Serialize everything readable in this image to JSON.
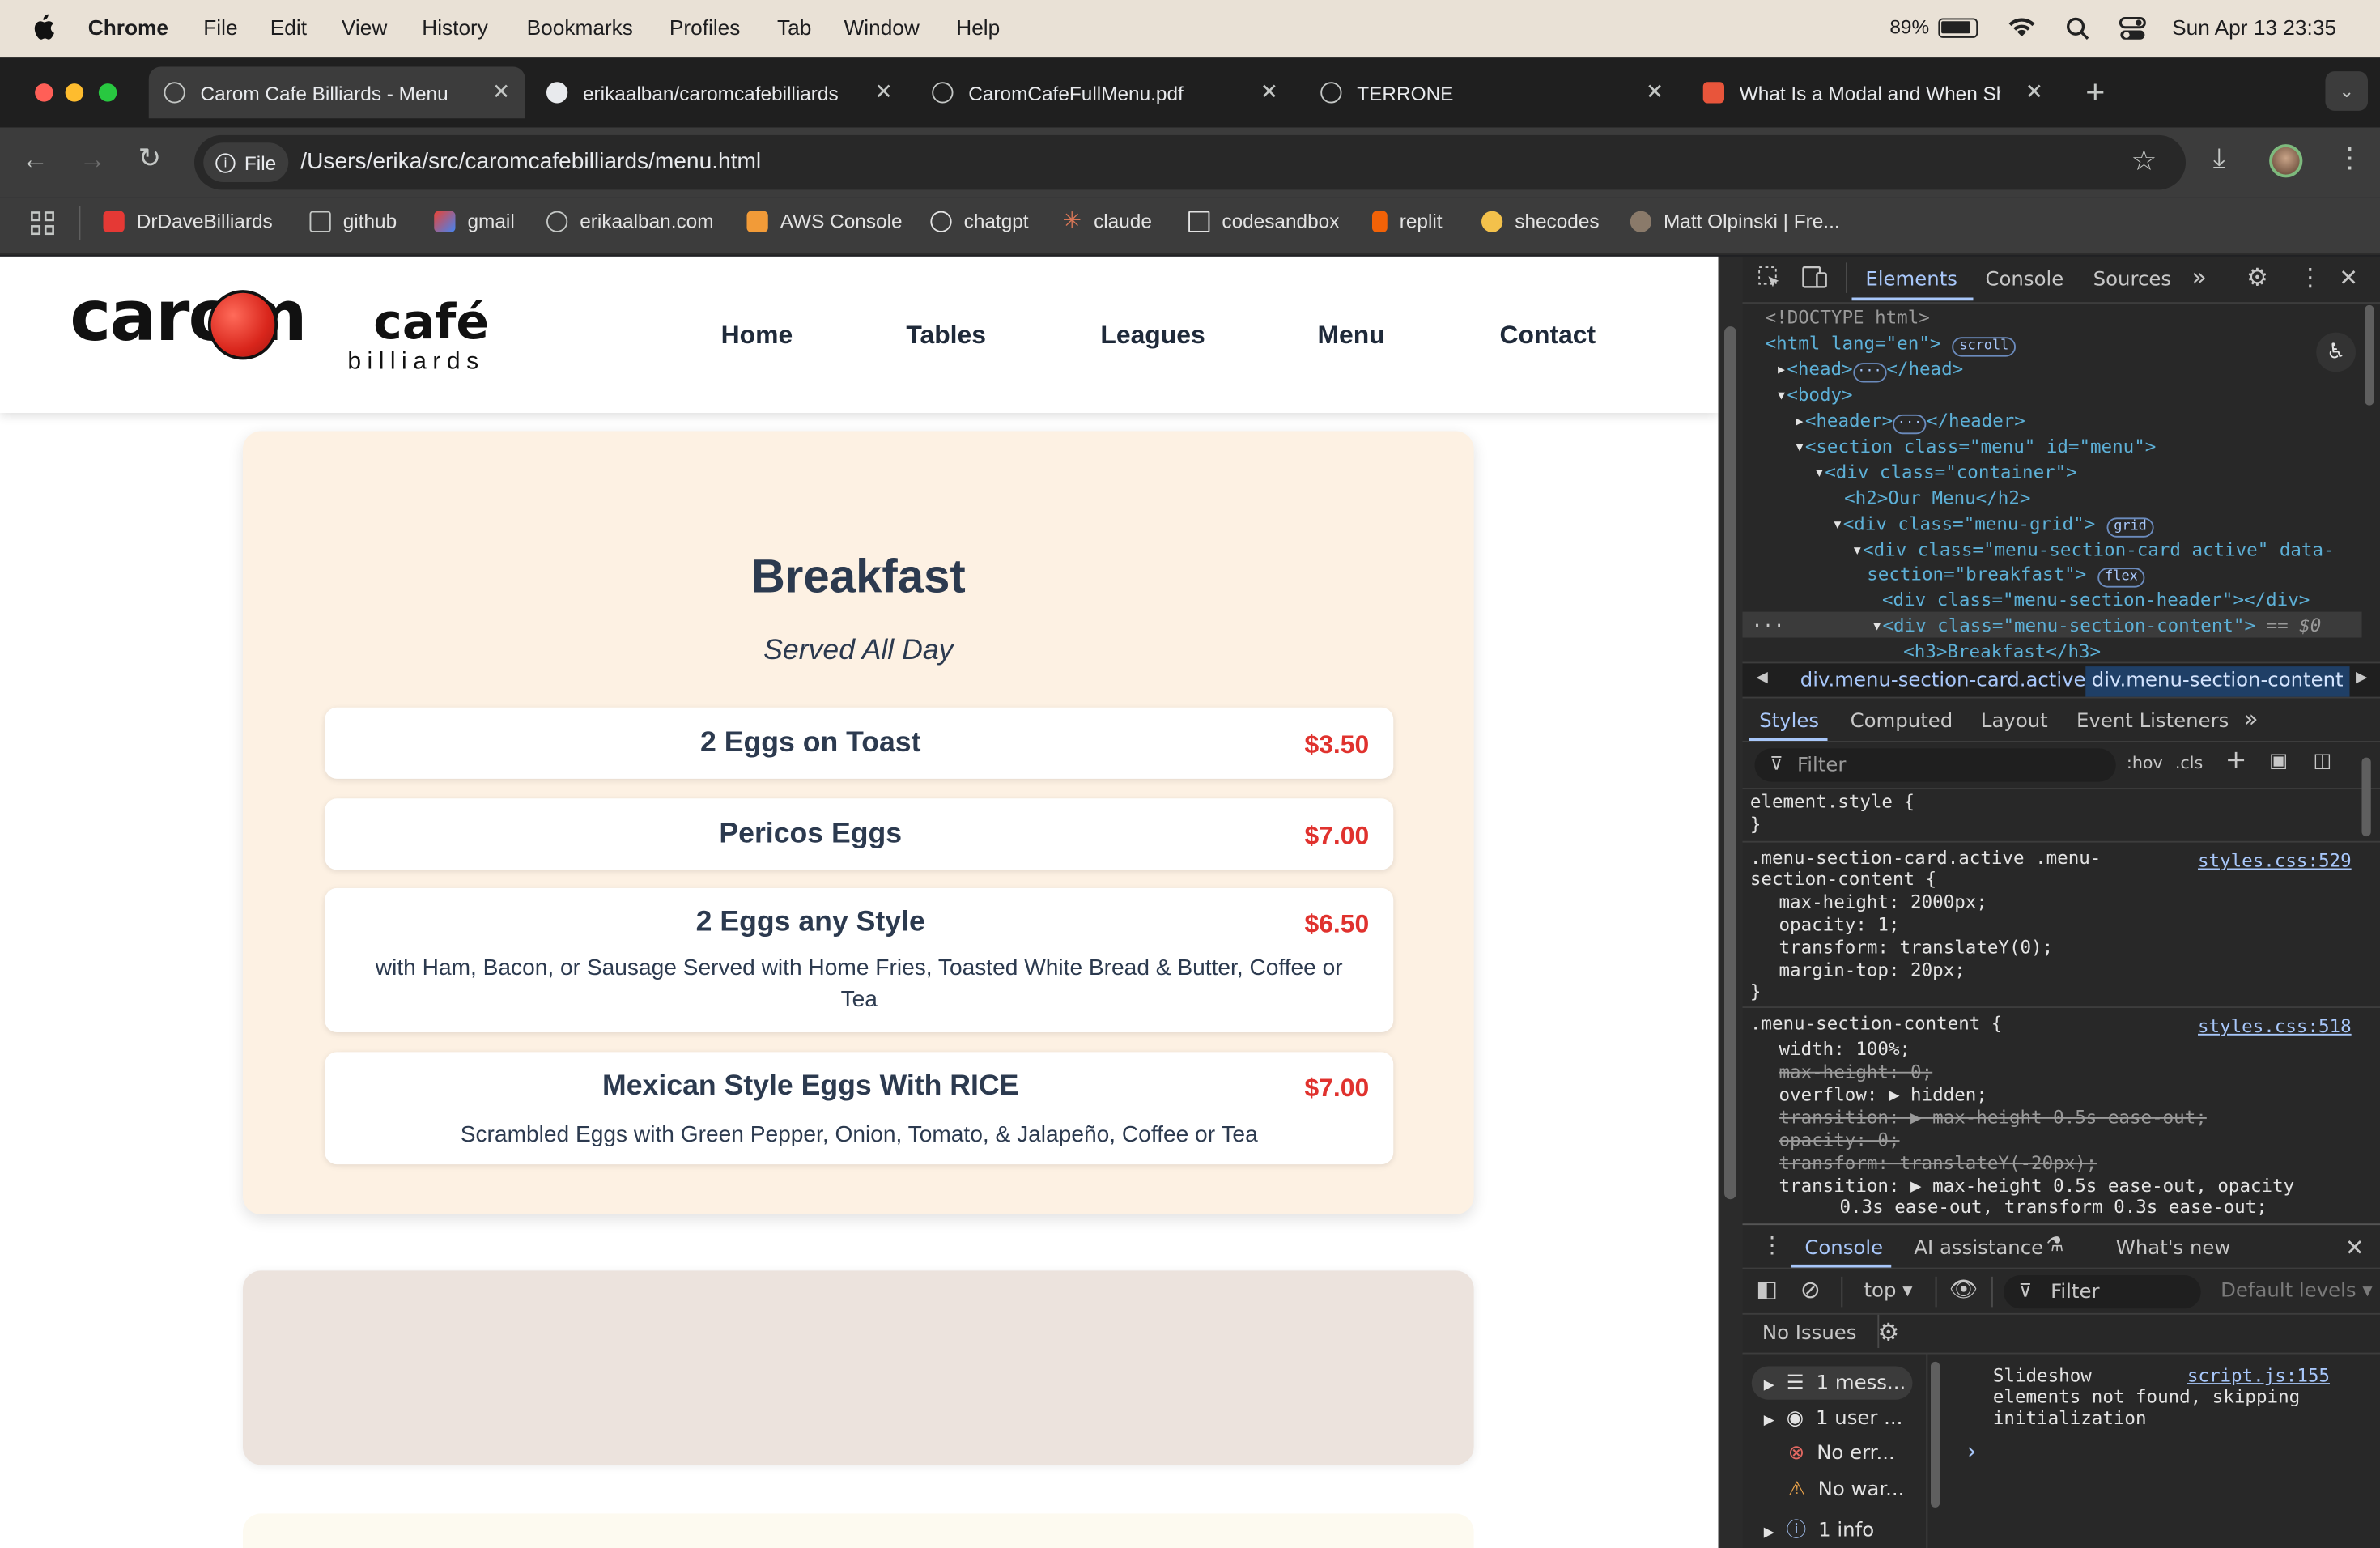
{
  "macos_menubar": {
    "app": "Chrome",
    "items": [
      "File",
      "Edit",
      "View",
      "History",
      "Bookmarks",
      "Profiles",
      "Tab",
      "Window",
      "Help"
    ],
    "battery": "89%",
    "datetime": "Sun Apr 13  23:35"
  },
  "tabs": [
    {
      "title": "Carom Cafe Billiards - Menu",
      "active": true,
      "icon": "globe-icon"
    },
    {
      "title": "erikaalban/caromcafebilliards",
      "active": false,
      "icon": "github-icon"
    },
    {
      "title": "CaromCafeFullMenu.pdf",
      "active": false,
      "icon": "globe-icon"
    },
    {
      "title": "TERRONE",
      "active": false,
      "icon": "globe-icon"
    },
    {
      "title": "What Is a Modal and When Sh",
      "active": false,
      "icon": "hashnode-icon"
    }
  ],
  "address_bar": {
    "chip": "File",
    "url": "/Users/erika/src/caromcafebilliards/menu.html"
  },
  "bookmarks": [
    "DrDaveBilliards",
    "github",
    "gmail",
    "erikaalban.com",
    "AWS Console",
    "chatgpt",
    "claude",
    "codesandbox",
    "replit",
    "shecodes",
    "Matt Olpinski | Fre..."
  ],
  "site": {
    "logo": {
      "word": "carom",
      "cafe": "café",
      "sub": "billiards"
    },
    "nav": [
      "Home",
      "Tables",
      "Leagues",
      "Menu",
      "Contact"
    ],
    "section": {
      "title": "Breakfast",
      "subtitle": "Served All Day",
      "items": [
        {
          "name": "2 Eggs on Toast",
          "price": "$3.50",
          "desc": ""
        },
        {
          "name": "Pericos Eggs",
          "price": "$7.00",
          "desc": ""
        },
        {
          "name": "2 Eggs any Style",
          "price": "$6.50",
          "desc": "with Ham, Bacon, or Sausage Served with Home Fries, Toasted White Bread & Butter, Coffee or Tea"
        },
        {
          "name": "Mexican Style Eggs With RICE",
          "price": "$7.00",
          "desc": "Scrambled Eggs with Green Pepper, Onion, Tomato, & Jalapeño, Coffee or Tea"
        }
      ]
    }
  },
  "devtools": {
    "tabs": [
      "Elements",
      "Console",
      "Sources"
    ],
    "dom": [
      "<!DOCTYPE html>",
      "<html lang=\"en\">",
      "<head>",
      "</head>",
      "<body>",
      "<header>",
      "</header>",
      "<section class=\"menu\" id=\"menu\">",
      "<div class=\"container\">",
      "<h2>Our Menu</h2>",
      "<div class=\"menu-grid\">",
      "<div class=\"menu-section-card active\" data-",
      "section=\"breakfast\">",
      "<div class=\"menu-section-header\"></div>",
      "<div class=\"menu-section-content\">",
      "== $0",
      "<h3>Breakfast</h3>"
    ],
    "dom_pills": {
      "scroll": "scroll",
      "grid": "grid",
      "flex": "flex"
    },
    "breadcrumbs": [
      "div.menu-section-card.active",
      "div.menu-section-content"
    ],
    "styles_tabs": [
      "Styles",
      "Computed",
      "Layout",
      "Event Listeners"
    ],
    "filter_placeholder": "Filter",
    "hov": ":hov",
    "cls": ".cls",
    "rules": [
      {
        "selector": "element.style {",
        "source": "",
        "props": []
      },
      {
        "selector": ".menu-section-card.active .menu-",
        "selector2": "section-content {",
        "source": "styles.css:529",
        "props": [
          "max-height: 2000px;",
          "opacity: 1;",
          "transform: translateY(0);",
          "margin-top: 20px;"
        ]
      },
      {
        "selector": ".menu-section-content {",
        "source": "styles.css:518",
        "props": [
          "width: 100%;",
          "max-height: 0;",
          "overflow: ▶ hidden;",
          "transition: ▶ max-height 0.5s ease-out;",
          "opacity: 0;",
          "transform: translateY(-20px);",
          "transition: ▶ max-height 0.5s ease-out, opacity",
          "0.3s ease-out, transform 0.3s ease-out;"
        ]
      }
    ],
    "drawer_tabs": [
      "Console",
      "AI assistance",
      "What's new"
    ],
    "console_context": "top ▾",
    "console_filter": "Filter",
    "levels": "Default levels ▾",
    "issues": "No Issues",
    "sidebar": [
      "1 mess...",
      "1 user ...",
      "No err...",
      "No war...",
      "1 info"
    ],
    "message": [
      "Slideshow",
      "elements not found, skipping",
      "initialization"
    ],
    "message_source": "script.js:155"
  }
}
